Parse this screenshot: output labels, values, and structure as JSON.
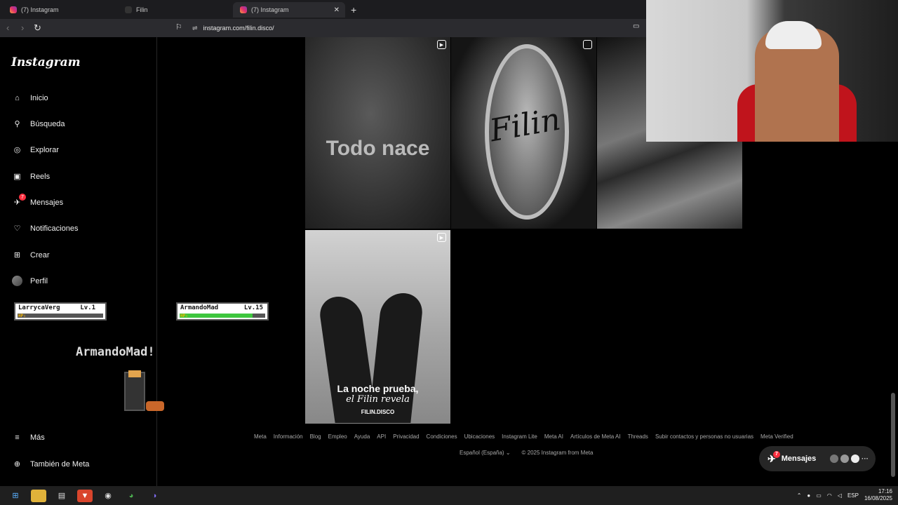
{
  "browser": {
    "tabs": [
      {
        "label": "(7) Instagram"
      },
      {
        "label": "Filin"
      },
      {
        "label": "(7) Instagram",
        "active": true
      }
    ],
    "close_glyph": "✕",
    "new_tab_glyph": "+",
    "url": "instagram.com/filin.disco/"
  },
  "sidebar": {
    "logo": "Instagram",
    "items": [
      {
        "label": "Inicio",
        "icon": "home-icon",
        "glyph": "⌂"
      },
      {
        "label": "Búsqueda",
        "icon": "search-icon",
        "glyph": "⚲"
      },
      {
        "label": "Explorar",
        "icon": "compass-icon",
        "glyph": "◎"
      },
      {
        "label": "Reels",
        "icon": "reels-icon",
        "glyph": "▣"
      },
      {
        "label": "Mensajes",
        "icon": "messenger-icon",
        "glyph": "✈",
        "badge": "7"
      },
      {
        "label": "Notificaciones",
        "icon": "heart-icon",
        "glyph": "♡"
      },
      {
        "label": "Crear",
        "icon": "plus-square-icon",
        "glyph": "⊞"
      },
      {
        "label": "Perfil",
        "icon": "avatar"
      }
    ],
    "more": {
      "label": "Más",
      "glyph": "≡"
    },
    "meta": {
      "label": "También de Meta",
      "glyph": "⊕"
    }
  },
  "overlay": {
    "player1": {
      "name": "LarrycaVerg",
      "level": "Lv.1",
      "hp_label": "HP:",
      "hp_fraction": 0
    },
    "player2": {
      "name": "ArmandoMad",
      "level": "Lv.15",
      "hp_label": "HP:",
      "hp_fraction": 0.85
    },
    "banner": "ArmandoMad!"
  },
  "posts": {
    "p1_text": "Todo nace",
    "p2_text": "Filin",
    "p4_line1": "La noche prueba,",
    "p4_line2": "el Filin revela",
    "p4_brand": "FILIN.DISCO"
  },
  "footer": {
    "links": [
      "Meta",
      "Información",
      "Blog",
      "Empleo",
      "Ayuda",
      "API",
      "Privacidad",
      "Condiciones",
      "Ubicaciones",
      "Instagram Lite",
      "Meta AI",
      "Artículos de Meta AI",
      "Threads",
      "Subir contactos y personas no usuarias",
      "Meta Verified"
    ],
    "language": "Español (España)",
    "copyright": "© 2025 Instagram from Meta"
  },
  "messages_button": {
    "label": "Mensajes",
    "badge": "7"
  },
  "taskbar": {
    "lang": "ESP",
    "time": "17:16",
    "date": "16/08/2025"
  },
  "colors": {
    "accent": "#ff3040",
    "hp_green": "#3ec63e"
  }
}
